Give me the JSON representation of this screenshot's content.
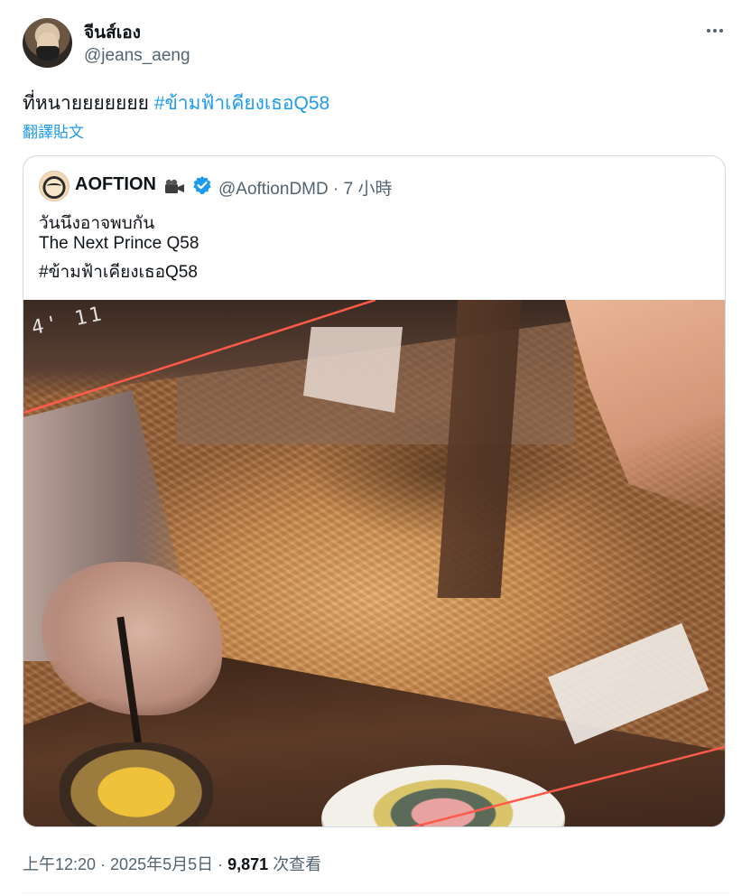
{
  "author": {
    "display_name": "จีนส์เอง",
    "handle": "@jeans_aeng"
  },
  "tweet": {
    "text": "ที่หนายยยยยยย",
    "hashtag": "#ข้ามฟ้าเคียงเธอQ58",
    "translate_label": "翻譯貼文"
  },
  "quoted_tweet": {
    "display_name": "AOFTION",
    "name_emoji_icon": "video-camera-icon",
    "verified_icon": "verified-badge-icon",
    "handle": "@AoftionDMD",
    "separator": " · ",
    "time": "7 小時",
    "lines": [
      "วันนึงอาจพบกัน",
      "The Next Prince Q58",
      "#ข้ามฟ้าเคียงเธอQ58"
    ],
    "photo": {
      "overlay_text": "4' 11"
    }
  },
  "meta": {
    "time": "上午12:20",
    "date": "2025年5月5日",
    "separator": " · ",
    "views_count": "9,871",
    "views_label": "次查看"
  },
  "colors": {
    "accent": "#1d9bf0",
    "secondary_text": "#536471",
    "border": "#cfd9de",
    "photo_line": "#ff5a4a"
  }
}
